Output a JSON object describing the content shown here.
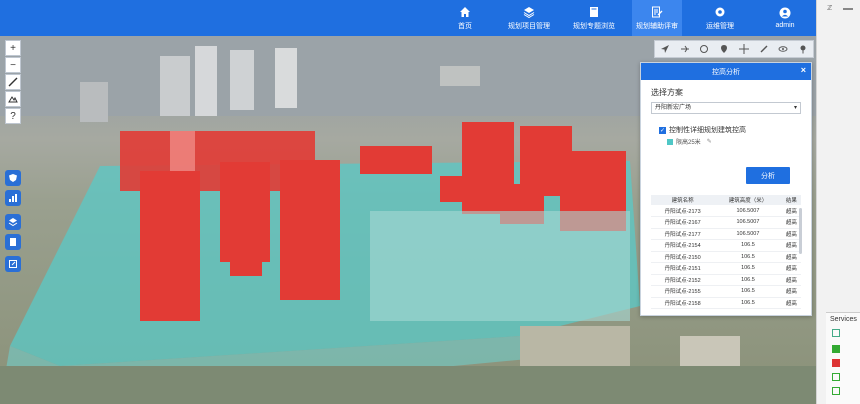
{
  "nav": [
    {
      "label": "首页",
      "icon": "home-icon",
      "active": false
    },
    {
      "label": "规划项目管理",
      "icon": "layers-icon",
      "active": false
    },
    {
      "label": "规划专题浏览",
      "icon": "book-icon",
      "active": false
    },
    {
      "label": "规划辅助评审",
      "icon": "review-icon",
      "active": true
    },
    {
      "label": "运维管理",
      "icon": "gear-icon",
      "active": false
    },
    {
      "label": "admin",
      "icon": "user-icon",
      "active": false
    }
  ],
  "left_tools": [
    "+",
    "−",
    "",
    "",
    " ?"
  ],
  "panel": {
    "title": "控高分析",
    "close": "×",
    "scheme_label": "选择方案",
    "scheme_value": "丹阳新宏广场",
    "checkbox_label": "控制性详细规划建筑控高",
    "legend_label": "限高25米",
    "analyze_button": "分析",
    "columns": [
      "建筑名称",
      "建筑高度（米）",
      "结果"
    ],
    "rows": [
      [
        "丹阳试点-2173",
        "106.5007",
        "超高"
      ],
      [
        "丹阳试点-2167",
        "106.5007",
        "超高"
      ],
      [
        "丹阳试点-2177",
        "106.5007",
        "超高"
      ],
      [
        "丹阳试点-2154",
        "106.5",
        "超高"
      ],
      [
        "丹阳试点-2150",
        "106.5",
        "超高"
      ],
      [
        "丹阳试点-2151",
        "106.5",
        "超高"
      ],
      [
        "丹阳试点-2152",
        "106.5",
        "超高"
      ],
      [
        "丹阳试点-2155",
        "106.5",
        "超高"
      ],
      [
        "丹阳试点-2158",
        "106.5",
        "超高"
      ]
    ]
  },
  "services_label": "Services",
  "colors": {
    "accent": "#1f6fe0",
    "overheight": "#e23b35",
    "limit_zone": "#4fc7c6"
  }
}
